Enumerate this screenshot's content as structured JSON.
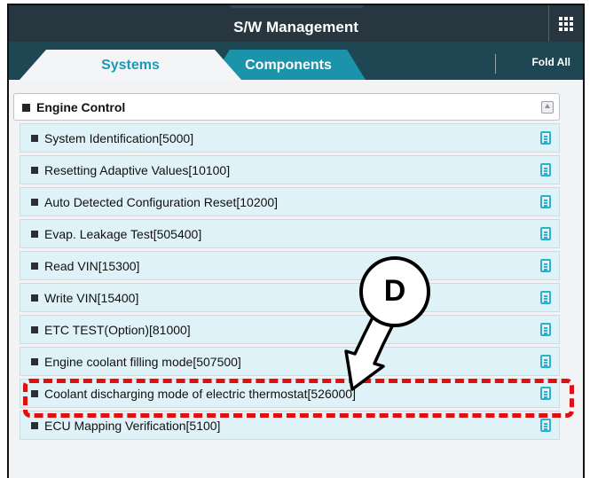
{
  "header": {
    "title": "S/W Management"
  },
  "tabs": {
    "systems": "Systems",
    "components": "Components"
  },
  "fold_all": "Fold All",
  "group": {
    "label": "Engine Control"
  },
  "items": [
    {
      "label": "System Identification[5000]"
    },
    {
      "label": "Resetting Adaptive Values[10100]"
    },
    {
      "label": "Auto Detected Configuration Reset[10200]"
    },
    {
      "label": "Evap. Leakage Test[505400]"
    },
    {
      "label": "Read VIN[15300]"
    },
    {
      "label": "Write VIN[15400]"
    },
    {
      "label": "ETC TEST(Option)[81000]"
    },
    {
      "label": "Engine coolant filling mode[507500]"
    },
    {
      "label": "Coolant discharging mode of electric thermostat[526000]"
    },
    {
      "label": "ECU Mapping Verification[5100]"
    }
  ],
  "callout": {
    "label": "D"
  },
  "colors": {
    "highlight": "#e10f0f",
    "accent": "#1a9ab8",
    "header": "#27363f"
  },
  "icons": {
    "menu": "grid-icon",
    "doc": "document-icon",
    "collapse": "collapse-up-icon"
  }
}
